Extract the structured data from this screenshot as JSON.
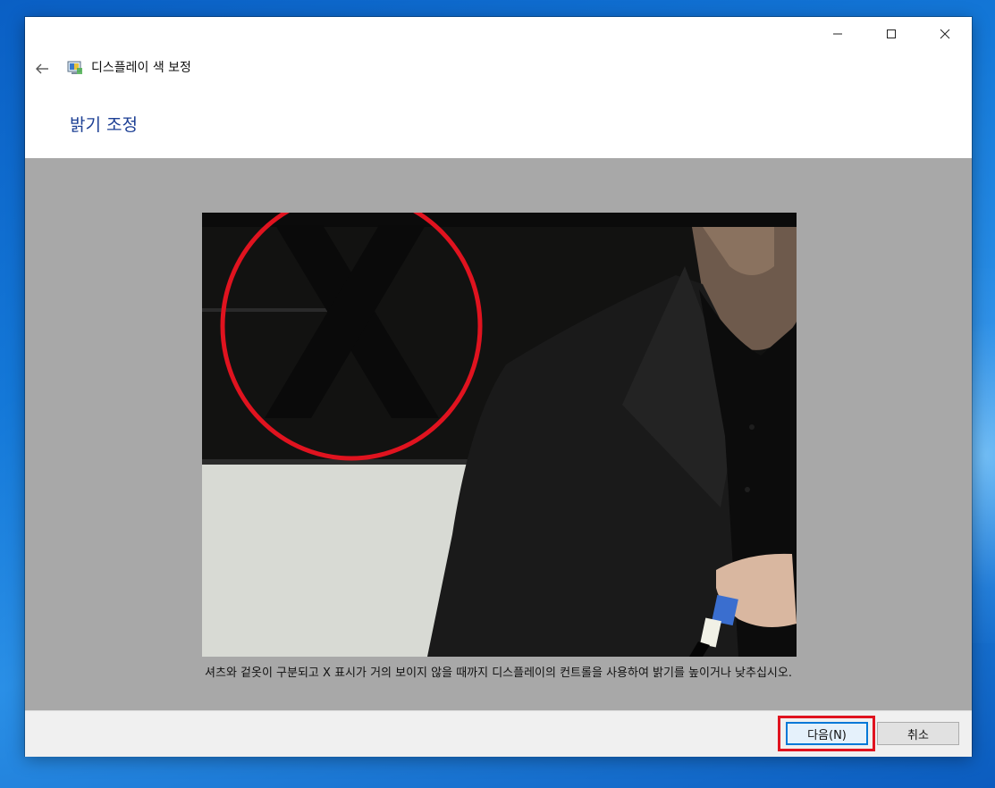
{
  "window": {
    "app_title": "디스플레이 색 보정",
    "page_title": "밝기 조정",
    "caption": {
      "minimize": "minimize-icon",
      "maximize": "maximize-icon",
      "close": "close-icon"
    }
  },
  "content": {
    "image_label": "",
    "instruction": "셔츠와 겉옷이 구분되고 X 표시가 거의 보이지 않을 때까지 디스플레이의 컨트롤을 사용하여 밝기를 높이거나 낮추십시오."
  },
  "footer": {
    "next_label": "다음(N)",
    "cancel_label": "취소"
  },
  "colors": {
    "title_blue": "#1c3f94",
    "content_bg": "#a8a8a8",
    "highlight_red": "#e0131f",
    "button_focus": "#0078d7"
  }
}
